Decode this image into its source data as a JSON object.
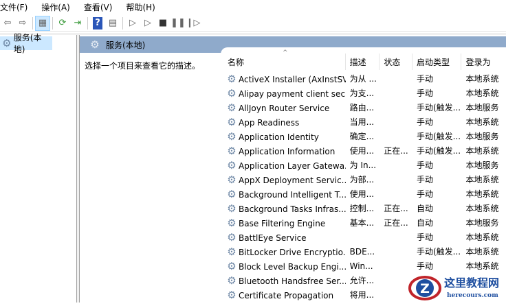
{
  "menu": [
    "文件(F)",
    "操作(A)",
    "查看(V)",
    "帮助(H)"
  ],
  "toolbar": [
    {
      "icon": "back-arrow-icon",
      "glyph": "⇦"
    },
    {
      "icon": "forward-arrow-icon",
      "glyph": "⇨"
    },
    {
      "sep": true
    },
    {
      "icon": "show-hide-console-tree-icon",
      "glyph": "▦",
      "active": true
    },
    {
      "sep": true
    },
    {
      "icon": "refresh-icon",
      "glyph": "⟳"
    },
    {
      "icon": "export-list-icon",
      "glyph": "⇥"
    },
    {
      "sep": true
    },
    {
      "icon": "help-icon",
      "glyph": "?"
    },
    {
      "icon": "show-action-pane-icon",
      "glyph": "▤"
    },
    {
      "sep": true
    },
    {
      "icon": "start-icon",
      "glyph": "▷"
    },
    {
      "icon": "start-alt-icon",
      "glyph": "▷"
    },
    {
      "icon": "stop-icon",
      "glyph": "■"
    },
    {
      "icon": "pause-icon",
      "glyph": "❚❚"
    },
    {
      "icon": "restart-icon",
      "glyph": "❙▷"
    }
  ],
  "tree": {
    "item": "服务(本地)"
  },
  "panel": {
    "title": "服务(本地)",
    "description": "选择一个项目来查看它的描述。"
  },
  "columns": [
    "名称",
    "描述",
    "状态",
    "启动类型",
    "登录为"
  ],
  "rows": [
    [
      "ActiveX Installer (AxInstSV)",
      "为从 ...",
      "",
      "手动",
      "本地系统"
    ],
    [
      "Alipay payment client sec...",
      "为支...",
      "",
      "手动",
      "本地系统"
    ],
    [
      "AllJoyn Router Service",
      "路由...",
      "",
      "手动(触发...",
      "本地服务"
    ],
    [
      "App Readiness",
      "当用...",
      "",
      "手动",
      "本地系统"
    ],
    [
      "Application Identity",
      "确定...",
      "",
      "手动(触发...",
      "本地服务"
    ],
    [
      "Application Information",
      "使用...",
      "正在...",
      "手动(触发...",
      "本地系统"
    ],
    [
      "Application Layer Gatewa...",
      "为 In...",
      "",
      "手动",
      "本地服务"
    ],
    [
      "AppX Deployment Servic...",
      "为部...",
      "",
      "手动",
      "本地系统"
    ],
    [
      "Background Intelligent T...",
      "使用...",
      "",
      "手动",
      "本地系统"
    ],
    [
      "Background Tasks Infras...",
      "控制...",
      "正在...",
      "自动",
      "本地系统"
    ],
    [
      "Base Filtering Engine",
      "基本...",
      "正在...",
      "自动",
      "本地服务"
    ],
    [
      "BattlEye Service",
      "",
      "",
      "手动",
      "本地系统"
    ],
    [
      "BitLocker Drive Encryptio...",
      "BDE...",
      "",
      "手动(触发...",
      "本地系统"
    ],
    [
      "Block Level Backup Engi...",
      "Win...",
      "",
      "手动",
      "本地系统"
    ],
    [
      "Bluetooth Handsfree Ser...",
      "允许...",
      "",
      "",
      ""
    ],
    [
      "Certificate Propagation",
      "将用...",
      "",
      "",
      ""
    ]
  ],
  "watermark": {
    "title": "这里教程网",
    "url": "herecours.com"
  }
}
